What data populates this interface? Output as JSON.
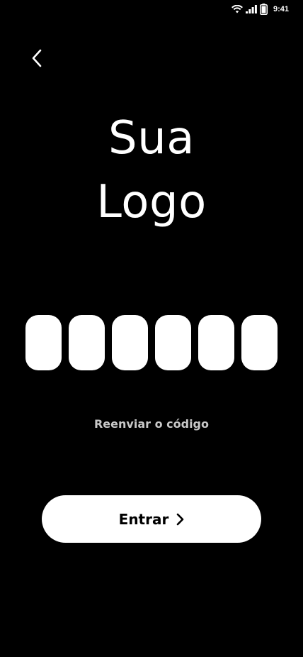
{
  "status_bar": {
    "time": "9:41",
    "icons": [
      "wifi-icon",
      "signal-icon",
      "battery-icon"
    ]
  },
  "header": {
    "back_icon": "chevron-left-icon"
  },
  "logo": {
    "line1": "Sua",
    "line2": "Logo"
  },
  "code_input": {
    "length": 6,
    "values": [
      "",
      "",
      "",
      "",
      "",
      ""
    ]
  },
  "resend": {
    "label": "Reenviar o código"
  },
  "enter_button": {
    "label": "Entrar",
    "icon": "chevron-right-icon"
  },
  "colors": {
    "background": "#000000",
    "foreground": "#ffffff",
    "muted_text": "#c8c8c8",
    "button_text": "#000000"
  }
}
